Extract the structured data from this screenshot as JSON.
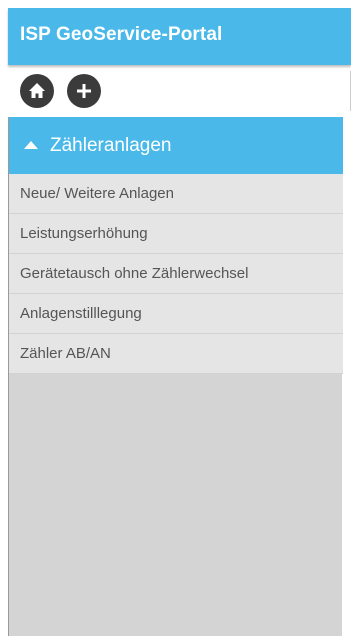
{
  "header": {
    "title": "ISP GeoService-Portal"
  },
  "toolbar": {
    "home_icon": "home-icon",
    "add_icon": "plus-icon"
  },
  "section": {
    "label": "Zähleranlagen",
    "state": "expanded",
    "items": [
      {
        "label": "Neue/ Weitere Anlagen"
      },
      {
        "label": "Leistungserhöhung"
      },
      {
        "label": "Gerätetausch ohne Zählerwechsel"
      },
      {
        "label": "Anlagenstilllegung"
      },
      {
        "label": "Zähler AB/AN"
      }
    ]
  },
  "colors": {
    "accent": "#4ab9ea",
    "icon_button": "#3b3b3b",
    "menu_item_bg": "#e5e5e5",
    "panel_bg": "#d4d4d4"
  }
}
